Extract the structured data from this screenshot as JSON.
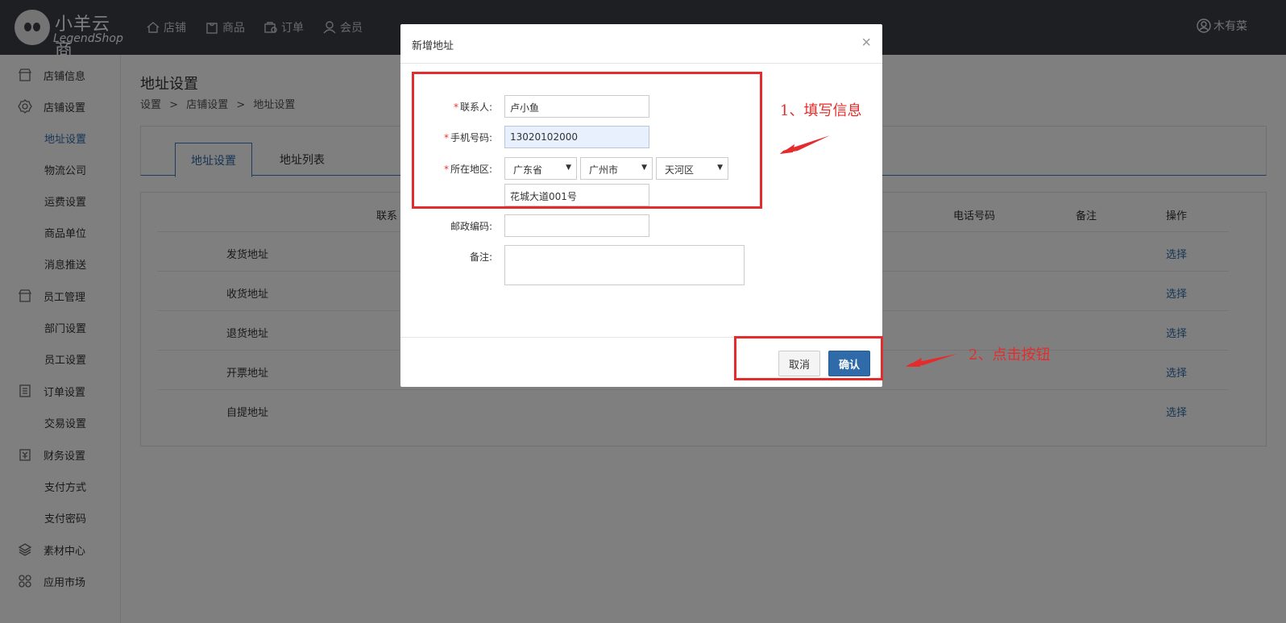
{
  "brand": {
    "name_cn": "小羊云商",
    "name_en": "LegendShop"
  },
  "nav": [
    {
      "label": "店铺",
      "icon": "home-icon"
    },
    {
      "label": "商品",
      "icon": "shopping-bag-icon"
    },
    {
      "label": "订单",
      "icon": "order-icon"
    },
    {
      "label": "会员",
      "icon": "user-icon"
    }
  ],
  "user": {
    "name": "木有菜"
  },
  "sidebar": [
    {
      "label": "店铺信息",
      "type": "group",
      "icon": "store-icon"
    },
    {
      "label": "店铺设置",
      "type": "group",
      "icon": "gear-icon"
    },
    {
      "label": "地址设置",
      "type": "sub",
      "active": true
    },
    {
      "label": "物流公司",
      "type": "sub"
    },
    {
      "label": "运费设置",
      "type": "sub"
    },
    {
      "label": "商品单位",
      "type": "sub"
    },
    {
      "label": "消息推送",
      "type": "sub"
    },
    {
      "label": "员工管理",
      "type": "group",
      "icon": "store-icon"
    },
    {
      "label": "部门设置",
      "type": "sub"
    },
    {
      "label": "员工设置",
      "type": "sub"
    },
    {
      "label": "订单设置",
      "type": "group",
      "icon": "document-icon"
    },
    {
      "label": "交易设置",
      "type": "sub"
    },
    {
      "label": "财务设置",
      "type": "group",
      "icon": "finance-icon"
    },
    {
      "label": "支付方式",
      "type": "sub"
    },
    {
      "label": "支付密码",
      "type": "sub"
    },
    {
      "label": "素材中心",
      "type": "group",
      "icon": "layers-icon"
    },
    {
      "label": "应用市场",
      "type": "group",
      "icon": "apps-icon"
    }
  ],
  "page": {
    "title": "地址设置",
    "breadcrumb": [
      "设置",
      ">",
      "店铺设置",
      ">",
      "地址设置"
    ],
    "tabs": [
      "地址设置",
      "地址列表"
    ]
  },
  "table": {
    "headers": {
      "contact": "联系",
      "phone": "电话号码",
      "remark": "备注",
      "action": "操作"
    },
    "rows": [
      {
        "name": "发货地址",
        "op": "选择"
      },
      {
        "name": "收货地址",
        "op": "选择"
      },
      {
        "name": "退货地址",
        "op": "选择"
      },
      {
        "name": "开票地址",
        "op": "选择"
      },
      {
        "name": "自提地址",
        "op": "选择"
      }
    ]
  },
  "modal": {
    "title": "新增地址",
    "close": "×",
    "fields": {
      "contact_label": "联系人:",
      "contact_value": "卢小鱼",
      "phone_label": "手机号码:",
      "phone_value": "13020102000",
      "region_label": "所在地区:",
      "province": "广东省",
      "city": "广州市",
      "district": "天河区",
      "address_value": "花城大道001号",
      "zip_label": "邮政编码:",
      "zip_value": "",
      "remark_label": "备注:",
      "required_mark": "*"
    },
    "cancel_label": "取消",
    "ok_label": "确认"
  },
  "annotations": {
    "step1": "1、填写信息",
    "step2": "2、点击按钮",
    "color": "#e52c2c"
  }
}
